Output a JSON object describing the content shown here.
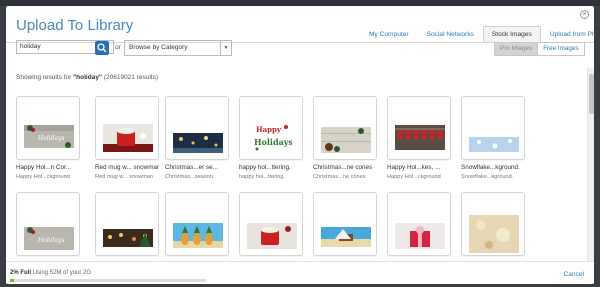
{
  "modal": {
    "title": "Upload To Library",
    "close_glyph": "×",
    "tabs": [
      {
        "label": "My Computer",
        "active": false
      },
      {
        "label": "Social Networks",
        "active": false
      },
      {
        "label": "Stock Images",
        "active": true
      },
      {
        "label": "Upload from Phone",
        "active": false
      }
    ]
  },
  "search": {
    "value": "holiday",
    "or_label": "or",
    "category_select": "Browse by Category"
  },
  "filter": {
    "pro_label": "Pro Images",
    "free_label": "Free Images",
    "selected": "Pro Images"
  },
  "results": {
    "prefix": "Showing results for",
    "query": "\"holiday\"",
    "count": "(20619021 results)"
  },
  "images": [
    {
      "title": "Happy Hol...n Cor...",
      "sub": "Happy Hol...ckground",
      "scene": "rustic"
    },
    {
      "title": "Red mug w... snowman",
      "sub": "Red mug w... snowman",
      "scene": "mug"
    },
    {
      "title": "Christmas...er se...",
      "sub": "Christmas...season.",
      "scene": "night"
    },
    {
      "title": "happy hol...ttering.",
      "sub": "happy hol...ttering.",
      "scene": "lettering"
    },
    {
      "title": "Christmas...ne cones",
      "sub": "Christmas...ne cones",
      "scene": "wood"
    },
    {
      "title": "Happy Hol...kes, ...",
      "sub": "Happy Hol...ckground",
      "scene": "garland"
    },
    {
      "title": "Snowflake...kground.",
      "sub": "Snowflake...kground.",
      "scene": "snow"
    },
    {
      "title": "",
      "sub": "",
      "scene": "rustic"
    },
    {
      "title": "",
      "sub": "",
      "scene": "lights"
    },
    {
      "title": "",
      "sub": "",
      "scene": "pineapples"
    },
    {
      "title": "",
      "sub": "",
      "scene": "mug2"
    },
    {
      "title": "",
      "sub": "",
      "scene": "beach"
    },
    {
      "title": "",
      "sub": "",
      "scene": "gift"
    },
    {
      "title": "",
      "sub": "",
      "scene": "bokeh"
    }
  ],
  "footer": {
    "usage_strong": "2% Full",
    "usage_rest": "Using 52M of your 2G",
    "usage_fraction": 0.02,
    "cancel": "Cancel"
  },
  "colors": {
    "accent": "#3278b8",
    "title": "#4a88be",
    "progress": "#7ab82e"
  }
}
